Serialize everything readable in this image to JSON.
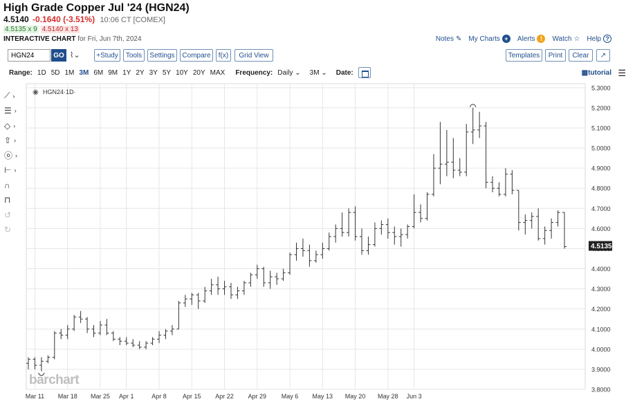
{
  "header": {
    "title": "High Grade Copper Jul '24 (HGN24)",
    "last": "4.5140",
    "change": "-0.1640 (-3.51%)",
    "time": "10:06 CT [COMEX]",
    "bid": "4.5135 x 9",
    "ask": "4.5140 x 13",
    "chart_label": "INTERACTIVE CHART",
    "chart_date": "for Fri, Jun 7th, 2024"
  },
  "top_links": {
    "notes": "Notes",
    "my_charts": "My Charts",
    "alerts": "Alerts",
    "watch": "Watch",
    "help": "Help"
  },
  "toolbar": {
    "symbol": "HGN24",
    "go": "GO",
    "study": "+Study",
    "tools": "Tools",
    "settings": "Settings",
    "compare": "Compare",
    "fx": "f(x)",
    "grid_view": "Grid View",
    "templates": "Templates",
    "print": "Print",
    "clear": "Clear"
  },
  "range_bar": {
    "range_label": "Range:",
    "ranges": [
      "1D",
      "5D",
      "1M",
      "3M",
      "6M",
      "9M",
      "1Y",
      "2Y",
      "3Y",
      "5Y",
      "10Y",
      "20Y",
      "MAX"
    ],
    "active_range": "3M",
    "frequency_label": "Frequency:",
    "frequency": "Daily",
    "period": "3M",
    "date_label": "Date:",
    "tutorial": "tutorial"
  },
  "legend_label": "HGN24·1D·",
  "watermark": "barchart",
  "colors": {
    "accent": "#1f4e8c",
    "down": "#d62d2d",
    "bid_bg": "#e3f3e3",
    "ask_bg": "#fbe3e3",
    "bar": "#333333"
  },
  "chart_data": {
    "type": "ohlc",
    "symbol": "HGN24",
    "interval": "1D",
    "x_tick_labels": [
      "Mar 11",
      "Mar 18",
      "Mar 25",
      "Apr 1",
      "Apr 8",
      "Apr 15",
      "Apr 22",
      "Apr 29",
      "May 6",
      "May 13",
      "May 20",
      "May 28",
      "Jun 3"
    ],
    "y_tick_labels": [
      "3.8000",
      "3.9000",
      "4.0000",
      "4.1000",
      "4.2000",
      "4.3000",
      "4.4000",
      "4.5000",
      "4.6000",
      "4.7000",
      "4.8000",
      "4.9000",
      "5.0000",
      "5.1000",
      "5.2000",
      "5.3000"
    ],
    "ylim": [
      3.8,
      5.32
    ],
    "last_price_label": "4.5135",
    "grid": true,
    "bars": [
      {
        "date": "Mar 8",
        "o": 3.93,
        "h": 3.96,
        "l": 3.9,
        "c": 3.95
      },
      {
        "date": "Mar 11",
        "o": 3.95,
        "h": 3.96,
        "l": 3.9,
        "c": 3.92
      },
      {
        "date": "Mar 12",
        "o": 3.92,
        "h": 3.96,
        "l": 3.89,
        "c": 3.94
      },
      {
        "date": "Mar 13",
        "o": 3.94,
        "h": 3.97,
        "l": 3.93,
        "c": 3.96
      },
      {
        "date": "Mar 14",
        "o": 3.96,
        "h": 4.09,
        "l": 3.95,
        "c": 4.08
      },
      {
        "date": "Mar 15",
        "o": 4.08,
        "h": 4.1,
        "l": 4.05,
        "c": 4.07
      },
      {
        "date": "Mar 18",
        "o": 4.07,
        "h": 4.12,
        "l": 4.05,
        "c": 4.1
      },
      {
        "date": "Mar 19",
        "o": 4.1,
        "h": 4.17,
        "l": 4.09,
        "c": 4.16
      },
      {
        "date": "Mar 20",
        "o": 4.16,
        "h": 4.19,
        "l": 4.13,
        "c": 4.15
      },
      {
        "date": "Mar 21",
        "o": 4.15,
        "h": 4.16,
        "l": 4.08,
        "c": 4.1
      },
      {
        "date": "Mar 22",
        "o": 4.1,
        "h": 4.12,
        "l": 4.06,
        "c": 4.08
      },
      {
        "date": "Mar 25",
        "o": 4.08,
        "h": 4.14,
        "l": 4.07,
        "c": 4.12
      },
      {
        "date": "Mar 26",
        "o": 4.12,
        "h": 4.15,
        "l": 4.07,
        "c": 4.08
      },
      {
        "date": "Mar 27",
        "o": 4.08,
        "h": 4.09,
        "l": 4.04,
        "c": 4.05
      },
      {
        "date": "Mar 28",
        "o": 4.05,
        "h": 4.06,
        "l": 4.02,
        "c": 4.04
      },
      {
        "date": "Apr 1",
        "o": 4.04,
        "h": 4.06,
        "l": 4.02,
        "c": 4.03
      },
      {
        "date": "Apr 2",
        "o": 4.03,
        "h": 4.05,
        "l": 4.01,
        "c": 4.02
      },
      {
        "date": "Apr 3",
        "o": 4.02,
        "h": 4.04,
        "l": 4.0,
        "c": 4.01
      },
      {
        "date": "Apr 4",
        "o": 4.01,
        "h": 4.04,
        "l": 4.0,
        "c": 4.03
      },
      {
        "date": "Apr 5",
        "o": 4.03,
        "h": 4.06,
        "l": 4.02,
        "c": 4.05
      },
      {
        "date": "Apr 8",
        "o": 4.05,
        "h": 4.09,
        "l": 4.03,
        "c": 4.07
      },
      {
        "date": "Apr 9",
        "o": 4.07,
        "h": 4.1,
        "l": 4.05,
        "c": 4.09
      },
      {
        "date": "Apr 10",
        "o": 4.09,
        "h": 4.12,
        "l": 4.07,
        "c": 4.1
      },
      {
        "date": "Apr 11",
        "o": 4.1,
        "h": 4.24,
        "l": 4.1,
        "c": 4.23
      },
      {
        "date": "Apr 12",
        "o": 4.23,
        "h": 4.27,
        "l": 4.21,
        "c": 4.25
      },
      {
        "date": "Apr 15",
        "o": 4.25,
        "h": 4.28,
        "l": 4.22,
        "c": 4.27
      },
      {
        "date": "Apr 16",
        "o": 4.27,
        "h": 4.28,
        "l": 4.2,
        "c": 4.24
      },
      {
        "date": "Apr 17",
        "o": 4.24,
        "h": 4.31,
        "l": 4.23,
        "c": 4.29
      },
      {
        "date": "Apr 18",
        "o": 4.29,
        "h": 4.35,
        "l": 4.27,
        "c": 4.32
      },
      {
        "date": "Apr 19",
        "o": 4.32,
        "h": 4.36,
        "l": 4.27,
        "c": 4.3
      },
      {
        "date": "Apr 22",
        "o": 4.3,
        "h": 4.34,
        "l": 4.27,
        "c": 4.31
      },
      {
        "date": "Apr 23",
        "o": 4.31,
        "h": 4.33,
        "l": 4.25,
        "c": 4.27
      },
      {
        "date": "Apr 24",
        "o": 4.27,
        "h": 4.31,
        "l": 4.25,
        "c": 4.29
      },
      {
        "date": "Apr 25",
        "o": 4.29,
        "h": 4.34,
        "l": 4.27,
        "c": 4.33
      },
      {
        "date": "Apr 26",
        "o": 4.33,
        "h": 4.38,
        "l": 4.31,
        "c": 4.37
      },
      {
        "date": "Apr 29",
        "o": 4.37,
        "h": 4.42,
        "l": 4.35,
        "c": 4.4
      },
      {
        "date": "Apr 30",
        "o": 4.4,
        "h": 4.41,
        "l": 4.31,
        "c": 4.33
      },
      {
        "date": "May 1",
        "o": 4.33,
        "h": 4.39,
        "l": 4.3,
        "c": 4.36
      },
      {
        "date": "May 2",
        "o": 4.36,
        "h": 4.38,
        "l": 4.32,
        "c": 4.35
      },
      {
        "date": "May 3",
        "o": 4.35,
        "h": 4.4,
        "l": 4.34,
        "c": 4.38
      },
      {
        "date": "May 6",
        "o": 4.38,
        "h": 4.48,
        "l": 4.37,
        "c": 4.47
      },
      {
        "date": "May 7",
        "o": 4.47,
        "h": 4.53,
        "l": 4.44,
        "c": 4.5
      },
      {
        "date": "May 8",
        "o": 4.5,
        "h": 4.55,
        "l": 4.46,
        "c": 4.49
      },
      {
        "date": "May 9",
        "o": 4.49,
        "h": 4.52,
        "l": 4.41,
        "c": 4.44
      },
      {
        "date": "May 10",
        "o": 4.44,
        "h": 4.49,
        "l": 4.43,
        "c": 4.47
      },
      {
        "date": "May 13",
        "o": 4.47,
        "h": 4.53,
        "l": 4.45,
        "c": 4.5
      },
      {
        "date": "May 14",
        "o": 4.5,
        "h": 4.58,
        "l": 4.49,
        "c": 4.56
      },
      {
        "date": "May 15",
        "o": 4.56,
        "h": 4.62,
        "l": 4.53,
        "c": 4.6
      },
      {
        "date": "May 16",
        "o": 4.6,
        "h": 4.68,
        "l": 4.56,
        "c": 4.58
      },
      {
        "date": "May 17",
        "o": 4.58,
        "h": 4.7,
        "l": 4.56,
        "c": 4.68
      },
      {
        "date": "May 20",
        "o": 4.68,
        "h": 4.71,
        "l": 4.54,
        "c": 4.56
      },
      {
        "date": "May 21",
        "o": 4.56,
        "h": 4.6,
        "l": 4.47,
        "c": 4.49
      },
      {
        "date": "May 22",
        "o": 4.49,
        "h": 4.56,
        "l": 4.47,
        "c": 4.52
      },
      {
        "date": "May 23",
        "o": 4.52,
        "h": 4.63,
        "l": 4.51,
        "c": 4.6
      },
      {
        "date": "May 24",
        "o": 4.6,
        "h": 4.64,
        "l": 4.57,
        "c": 4.62
      },
      {
        "date": "May 28",
        "o": 4.62,
        "h": 4.65,
        "l": 4.55,
        "c": 4.58
      },
      {
        "date": "May 29",
        "o": 4.58,
        "h": 4.61,
        "l": 4.52,
        "c": 4.56
      },
      {
        "date": "May 30",
        "o": 4.56,
        "h": 4.6,
        "l": 4.51,
        "c": 4.57
      },
      {
        "date": "May 31",
        "o": 4.57,
        "h": 4.62,
        "l": 4.55,
        "c": 4.61
      },
      {
        "date": "Jun 3",
        "o": 4.61,
        "h": 4.77,
        "l": 4.6,
        "c": 4.68
      },
      {
        "date": "Jun 4",
        "o": 4.68,
        "h": 4.72,
        "l": 4.63,
        "c": 4.65
      },
      {
        "date": "Jun 5",
        "o": 4.65,
        "h": 4.78,
        "l": 4.64,
        "c": 4.77
      },
      {
        "date": "Jun 6",
        "o": 4.77,
        "h": 4.97,
        "l": 4.76,
        "c": 4.9
      },
      {
        "date": "Jun 7",
        "o": 4.9,
        "h": 5.13,
        "l": 4.82,
        "c": 4.92
      },
      {
        "date": "Jun 10",
        "o": 4.92,
        "h": 5.09,
        "l": 4.86,
        "c": 4.93
      },
      {
        "date": "Jun 11",
        "o": 4.93,
        "h": 5.05,
        "l": 4.85,
        "c": 4.89
      },
      {
        "date": "Jun 12",
        "o": 4.89,
        "h": 4.95,
        "l": 4.86,
        "c": 4.88
      },
      {
        "date": "Jun 13",
        "o": 4.88,
        "h": 5.12,
        "l": 4.86,
        "c": 5.08
      },
      {
        "date": "Jun 14",
        "o": 5.08,
        "h": 5.2,
        "l": 5.02,
        "c": 5.09
      },
      {
        "date": "Jun 17",
        "o": 5.09,
        "h": 5.18,
        "l": 5.05,
        "c": 5.11
      },
      {
        "date": "Jun 18",
        "o": 5.11,
        "h": 5.13,
        "l": 4.8,
        "c": 4.83
      },
      {
        "date": "Jun 19",
        "o": 4.83,
        "h": 4.86,
        "l": 4.78,
        "c": 4.8
      },
      {
        "date": "Jun 20",
        "o": 4.8,
        "h": 4.83,
        "l": 4.76,
        "c": 4.77
      },
      {
        "date": "Jun 21",
        "o": 4.77,
        "h": 4.9,
        "l": 4.76,
        "c": 4.87
      },
      {
        "date": "Jun 24",
        "o": 4.87,
        "h": 4.89,
        "l": 4.77,
        "c": 4.79
      },
      {
        "date": "Jun 25",
        "o": 4.79,
        "h": 4.79,
        "l": 4.59,
        "c": 4.63
      },
      {
        "date": "Jun 26",
        "o": 4.63,
        "h": 4.67,
        "l": 4.57,
        "c": 4.64
      },
      {
        "date": "Jun 27",
        "o": 4.64,
        "h": 4.68,
        "l": 4.6,
        "c": 4.66
      },
      {
        "date": "Jun 28",
        "o": 4.66,
        "h": 4.7,
        "l": 4.54,
        "c": 4.55
      },
      {
        "date": "Jul 1",
        "o": 4.55,
        "h": 4.61,
        "l": 4.52,
        "c": 4.59
      },
      {
        "date": "Jul 2",
        "o": 4.59,
        "h": 4.65,
        "l": 4.55,
        "c": 4.63
      },
      {
        "date": "Jul 3",
        "o": 4.63,
        "h": 4.69,
        "l": 4.61,
        "c": 4.68
      },
      {
        "date": "Jul 4",
        "o": 4.68,
        "h": 4.68,
        "l": 4.5,
        "c": 4.51
      }
    ]
  }
}
